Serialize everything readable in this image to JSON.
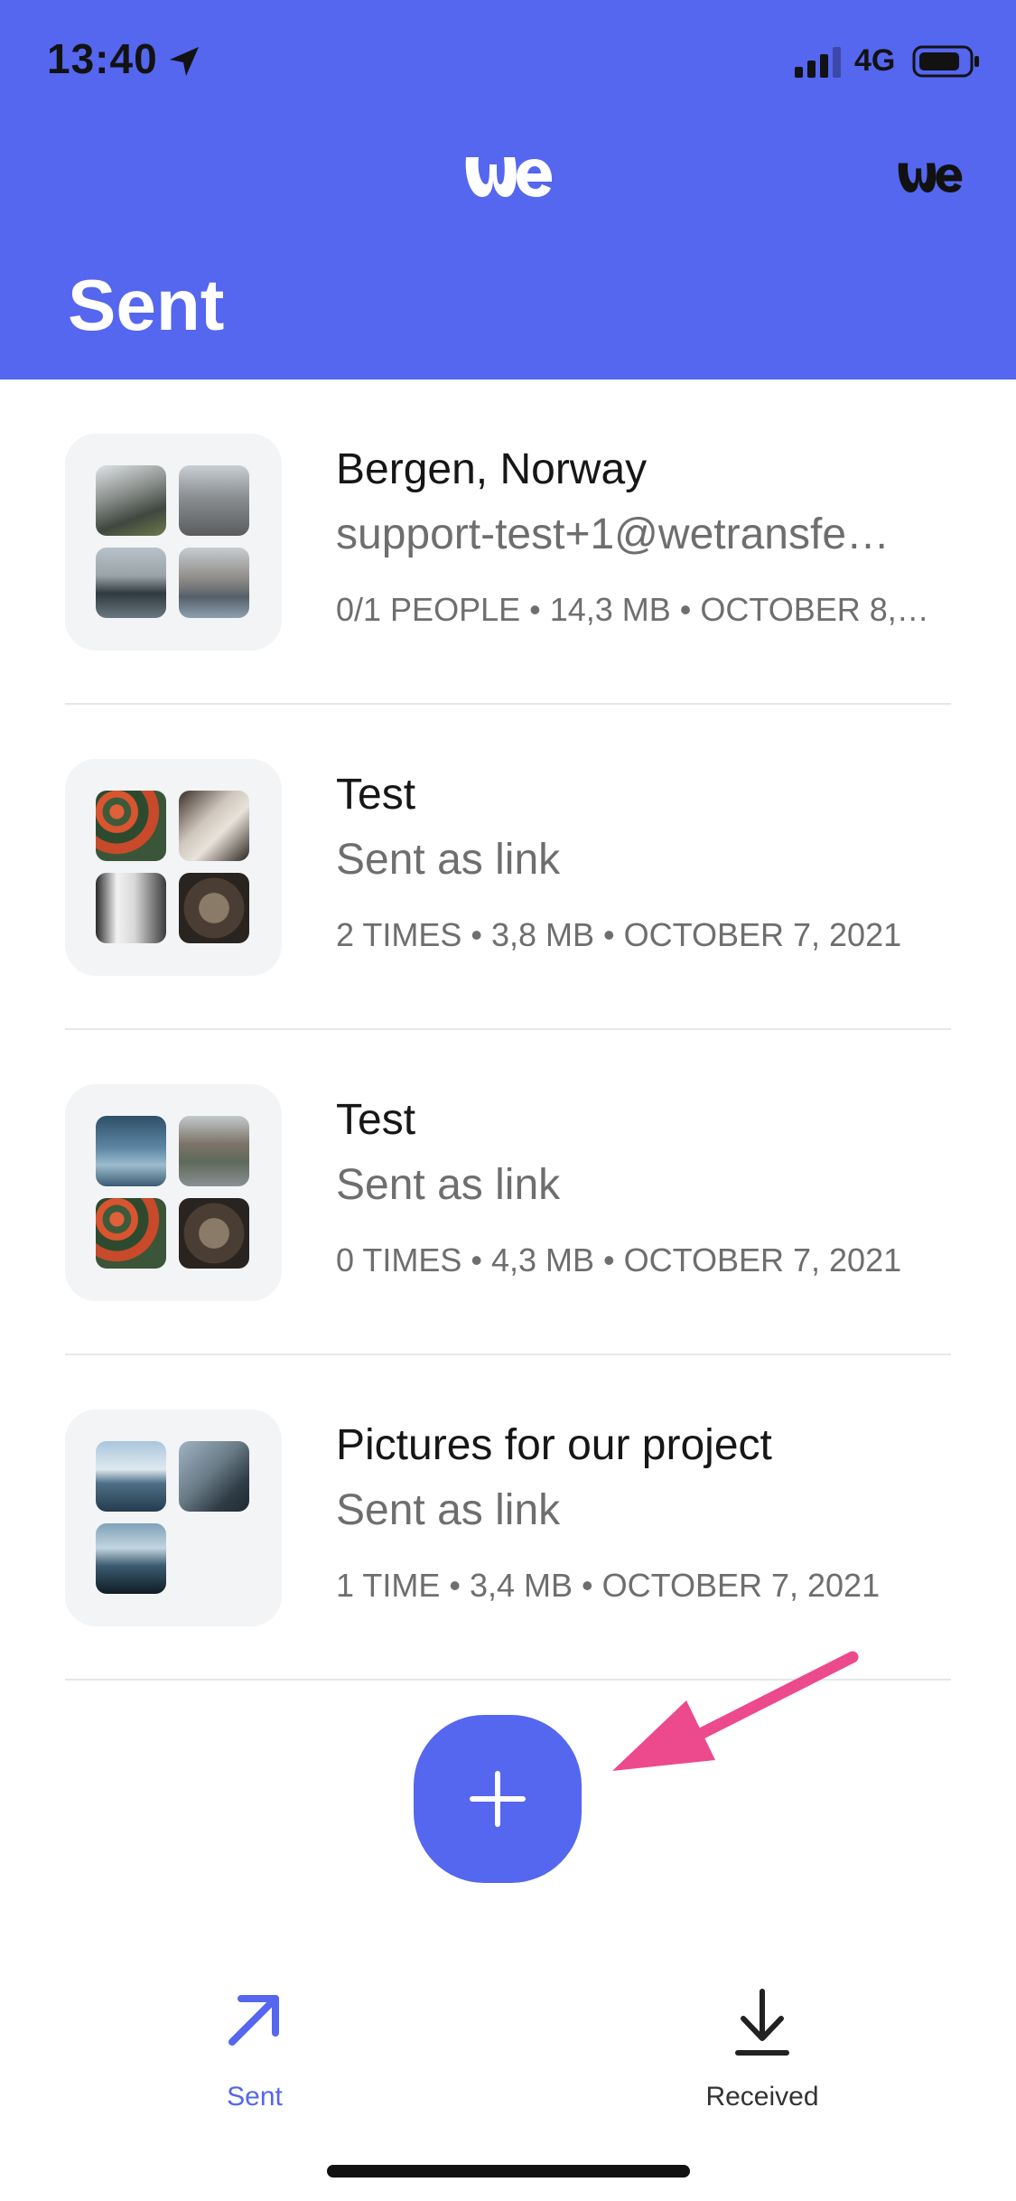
{
  "status_bar": {
    "time": "13:40",
    "network": "4G"
  },
  "header": {
    "title": "Sent"
  },
  "transfers": [
    {
      "title": "Bergen, Norway",
      "subtitle": "support-test+1@wetransfe…",
      "meta": "0/1 PEOPLE • 14,3 MB • OCTOBER 8,…"
    },
    {
      "title": "Test",
      "subtitle": "Sent as link",
      "meta": "2 TIMES • 3,8 MB • OCTOBER 7, 2021"
    },
    {
      "title": "Test",
      "subtitle": "Sent as link",
      "meta": "0 TIMES • 4,3 MB • OCTOBER 7, 2021"
    },
    {
      "title": "Pictures for our project",
      "subtitle": "Sent as link",
      "meta": "1 TIME • 3,4 MB • OCTOBER 7, 2021"
    }
  ],
  "fab": {
    "icon": "plus-icon"
  },
  "tabs": {
    "sent_label": "Sent",
    "received_label": "Received",
    "active": "Sent"
  },
  "colors": {
    "brand": "#5566ef",
    "annotation": "#ec4a8c",
    "header_text": "#ffffff"
  }
}
